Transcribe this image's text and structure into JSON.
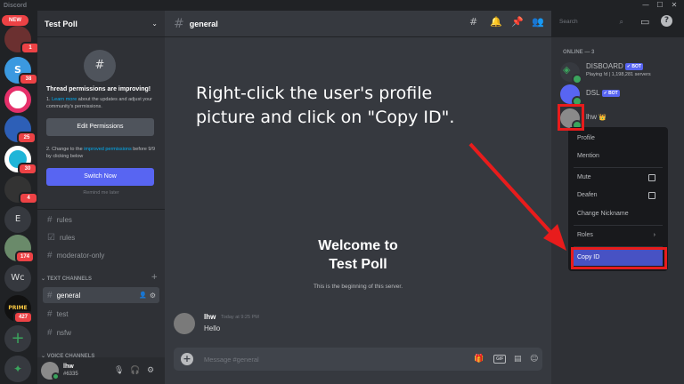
{
  "window": {
    "app_name": "Discord",
    "min": "—",
    "max": "☐",
    "close": "✕"
  },
  "rail": {
    "new_label": "NEW",
    "servers": [
      {
        "badge": "1"
      },
      {
        "letter": "S",
        "badge": "38"
      },
      {
        "badge": ""
      },
      {
        "badge": "25"
      },
      {
        "badge": "30"
      },
      {
        "badge": "4"
      },
      {
        "letter": "E",
        "badge": ""
      },
      {
        "badge": "174"
      },
      {
        "letter": "Wc",
        "badge": ""
      },
      {
        "letter": "PRIME",
        "badge": "427"
      }
    ],
    "add_label": "+",
    "explore_label": "✦"
  },
  "sidebar": {
    "guild_name": "Test Poll",
    "promo": {
      "title": "Thread permissions are improving!",
      "step1_prefix": "1. ",
      "step1_link": "Learn more",
      "step1_rest": " about the updates and adjust your community's permissions.",
      "edit_button": "Edit Permissions",
      "step2_prefix": "2. Change to the ",
      "step2_link": "improved permissions",
      "step2_rest": " before 9/9 by clicking below",
      "switch_button": "Switch Now",
      "remind": "Remind me later"
    },
    "top_channels": [
      {
        "name": "rules"
      },
      {
        "name": "rules"
      },
      {
        "name": "moderator-only"
      }
    ],
    "text_category": "TEXT CHANNELS",
    "text_channels": [
      {
        "name": "general",
        "active": true
      },
      {
        "name": "test"
      },
      {
        "name": "nsfw"
      }
    ],
    "voice_category": "VOICE CHANNELS",
    "user": {
      "name": "lhw",
      "tag": "#6335"
    }
  },
  "main": {
    "channel_name": "general",
    "welcome_line1": "Welcome to",
    "welcome_line2": "Test Poll",
    "welcome_sub": "This is the beginning of this server.",
    "message": {
      "author": "lhw",
      "time": "Today at 9:25 PM",
      "text": "Hello"
    },
    "composer_placeholder": "Message #general",
    "search_placeholder": "Search"
  },
  "members": {
    "header": "ONLINE — 3",
    "list": [
      {
        "name": "DISBOARD",
        "bot": "✓ BOT",
        "sub": "Playing !d | 1,198,281 servers",
        "color": "#b9bbbe"
      },
      {
        "name": "DSL",
        "bot": "✓ BOT",
        "sub": "",
        "color": "#b9bbbe"
      },
      {
        "name": "lhw",
        "crown": "👑",
        "sub": "",
        "color": "#b9bbbe"
      }
    ]
  },
  "context_menu": {
    "items": [
      "Profile",
      "Mention",
      "Mute",
      "Deafen",
      "Change Nickname",
      "Roles",
      "Copy ID"
    ],
    "highlight": "Copy ID"
  },
  "annotation": {
    "line1": "Right-click the user's profile",
    "line2": "picture and click on \"Copy ID\"."
  },
  "colors": {
    "accent": "#5865f2",
    "annotation_red": "#e81c1c",
    "online": "#3ba55d"
  }
}
